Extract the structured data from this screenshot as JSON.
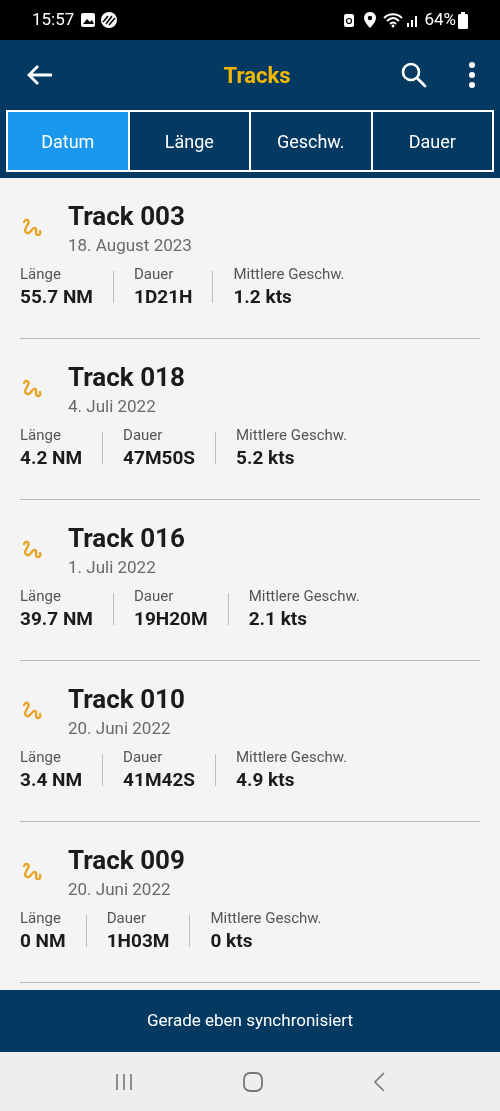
{
  "status_bar": {
    "time": "15:57",
    "battery": "64%"
  },
  "app_bar": {
    "title": "Tracks"
  },
  "tabs": [
    {
      "label": "Datum",
      "selected": true
    },
    {
      "label": "Länge",
      "selected": false
    },
    {
      "label": "Geschw.",
      "selected": false
    },
    {
      "label": "Dauer",
      "selected": false
    }
  ],
  "tracks": [
    {
      "name": "Track 003",
      "date": "18. August 2023",
      "stats": [
        {
          "label": "Länge",
          "value": "55.7 NM"
        },
        {
          "label": "Dauer",
          "value": "1D21H"
        },
        {
          "label": "Mittlere Geschw.",
          "value": "1.2 kts"
        }
      ]
    },
    {
      "name": "Track 018",
      "date": "4. Juli 2022",
      "stats": [
        {
          "label": "Länge",
          "value": "4.2 NM"
        },
        {
          "label": "Dauer",
          "value": "47M50S"
        },
        {
          "label": "Mittlere Geschw.",
          "value": "5.2 kts"
        }
      ]
    },
    {
      "name": "Track 016",
      "date": "1. Juli 2022",
      "stats": [
        {
          "label": "Länge",
          "value": "39.7 NM"
        },
        {
          "label": "Dauer",
          "value": "19H20M"
        },
        {
          "label": "Mittlere Geschw.",
          "value": "2.1 kts"
        }
      ]
    },
    {
      "name": "Track 010",
      "date": "20. Juni 2022",
      "stats": [
        {
          "label": "Länge",
          "value": "3.4 NM"
        },
        {
          "label": "Dauer",
          "value": "41M42S"
        },
        {
          "label": "Mittlere Geschw.",
          "value": "4.9 kts"
        }
      ]
    },
    {
      "name": "Track 009",
      "date": "20. Juni 2022",
      "stats": [
        {
          "label": "Länge",
          "value": "0 NM"
        },
        {
          "label": "Dauer",
          "value": "1H03M"
        },
        {
          "label": "Mittlere Geschw.",
          "value": "0 kts"
        }
      ]
    }
  ],
  "sync_bar": {
    "text": "Gerade eben synchronisiert"
  }
}
